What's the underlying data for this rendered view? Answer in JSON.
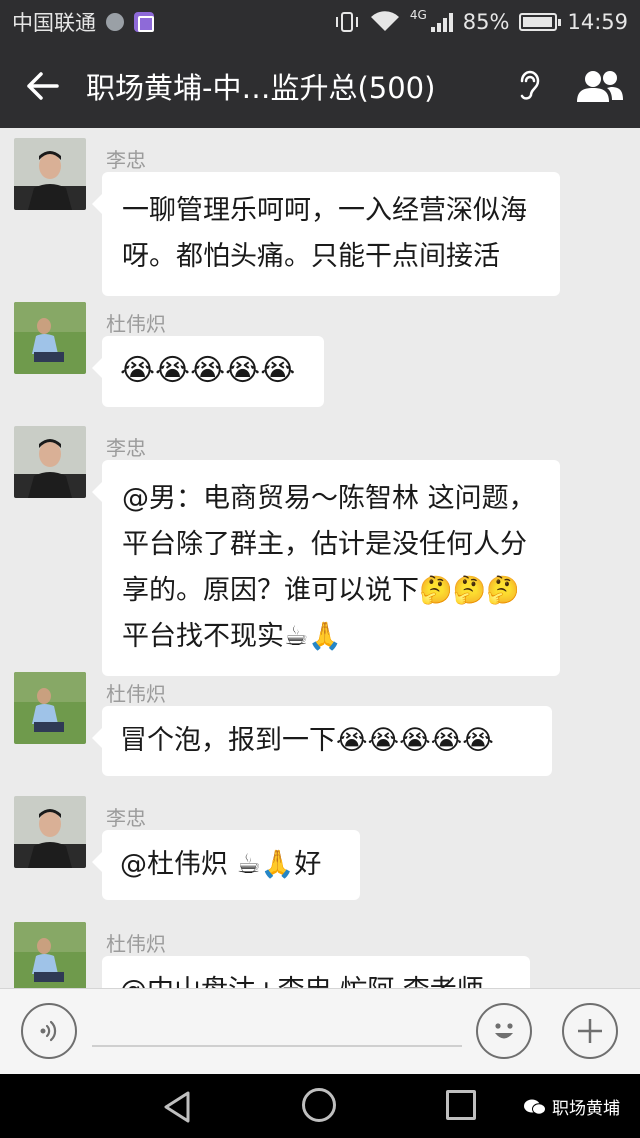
{
  "status_bar": {
    "carrier": "中国联通",
    "network": "4G",
    "battery": "85%",
    "time": "14:59"
  },
  "header": {
    "title": "职场黄埔-中…监升总(500)"
  },
  "messages": [
    {
      "sender": "李忠",
      "text": "一聊管理乐呵呵，一入经营深似海呀。都怕头痛。只能干点间接活"
    },
    {
      "sender": "杜伟炽",
      "text": "😭😭😭😭😭"
    },
    {
      "sender": "李忠",
      "text": "@男：电商贸易～陈智林 这问题，平台除了群主，估计是没任何人分享的。原因？谁可以说下🤔🤔🤔平台找不现实☕🙏"
    },
    {
      "sender": "杜伟炽",
      "text": "冒个泡，报到一下😭😭😭😭😭"
    },
    {
      "sender": "李忠",
      "text": "@杜伟炽 ☕🙏好"
    },
    {
      "sender": "杜伟炽",
      "text": "@中山盘沽+李忠 忙阿 李老师"
    }
  ],
  "watermark": "职场黄埔",
  "colors": {
    "bar_dark": "#2e2e30",
    "chat_bg": "#ebebeb",
    "bubble": "#ffffff"
  }
}
